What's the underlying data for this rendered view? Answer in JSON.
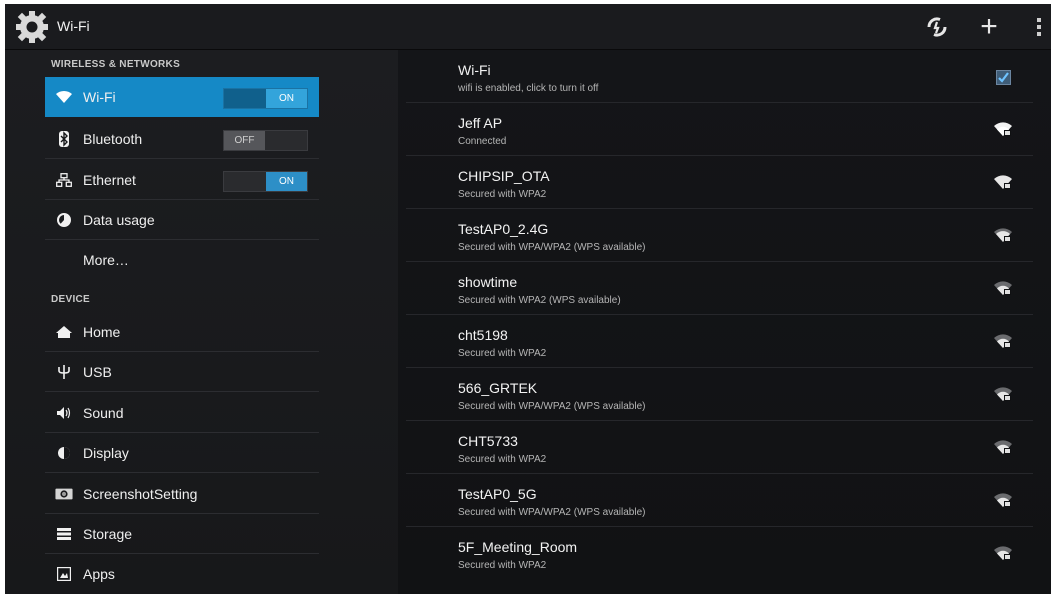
{
  "action_bar": {
    "title": "Wi-Fi",
    "icons": [
      "settings-gear-icon",
      "wps-sync-icon",
      "add-network-icon",
      "overflow-menu-icon"
    ]
  },
  "sidebar": {
    "sections": [
      {
        "header": "WIRELESS & NETWORKS",
        "items": [
          {
            "label": "Wi-Fi",
            "icon": "wifi-icon",
            "toggle": "ON",
            "selected": true
          },
          {
            "label": "Bluetooth",
            "icon": "bluetooth-icon",
            "toggle": "OFF"
          },
          {
            "label": "Ethernet",
            "icon": "ethernet-icon",
            "toggle": "ON"
          },
          {
            "label": "Data usage",
            "icon": "data-usage-icon"
          },
          {
            "label": "More…"
          }
        ]
      },
      {
        "header": "DEVICE",
        "items": [
          {
            "label": "Home",
            "icon": "home-icon"
          },
          {
            "label": "USB",
            "icon": "usb-icon"
          },
          {
            "label": "Sound",
            "icon": "sound-icon"
          },
          {
            "label": "Display",
            "icon": "display-icon"
          },
          {
            "label": "ScreenshotSetting",
            "icon": "camera-icon"
          },
          {
            "label": "Storage",
            "icon": "storage-icon"
          },
          {
            "label": "Apps",
            "icon": "apps-icon"
          }
        ]
      }
    ]
  },
  "wifi_toggle": {
    "title": "Wi-Fi",
    "subtitle": "wifi is enabled, click to turn it off",
    "checked": true
  },
  "networks": [
    {
      "ssid": "Jeff AP",
      "status": "Connected"
    },
    {
      "ssid": "CHIPSIP_OTA",
      "status": "Secured with WPA2"
    },
    {
      "ssid": "TestAP0_2.4G",
      "status": "Secured with WPA/WPA2 (WPS available)"
    },
    {
      "ssid": "showtime",
      "status": "Secured with WPA2 (WPS available)"
    },
    {
      "ssid": "cht5198",
      "status": "Secured with WPA2"
    },
    {
      "ssid": "566_GRTEK",
      "status": "Secured with WPA/WPA2 (WPS available)"
    },
    {
      "ssid": "CHT5733",
      "status": "Secured with WPA2"
    },
    {
      "ssid": "TestAP0_5G",
      "status": "Secured with WPA/WPA2 (WPS available)"
    },
    {
      "ssid": "5F_Meeting_Room",
      "status": "Secured with WPA2"
    }
  ],
  "colors": {
    "accent": "#1589c6",
    "background": "#101113",
    "toggle_on": "#2d8fc7"
  }
}
